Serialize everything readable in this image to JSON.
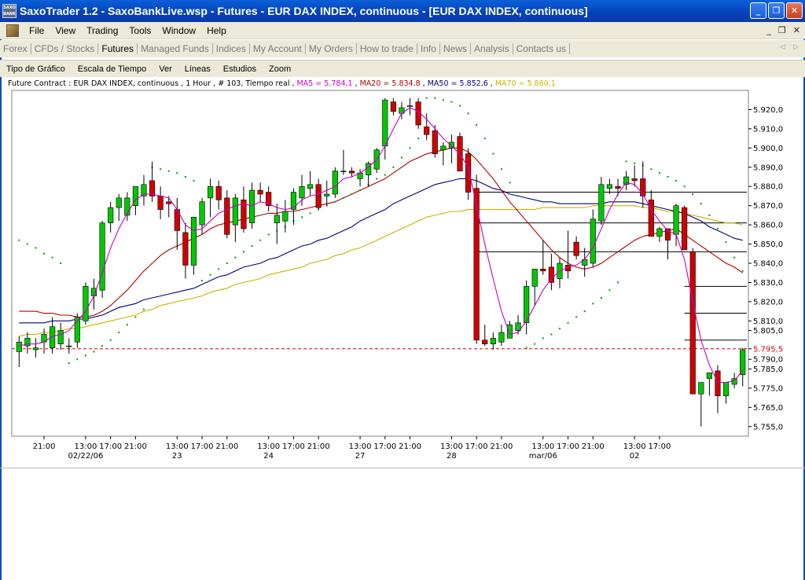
{
  "window": {
    "icon_text": "SAXO BANK",
    "title": "SaxoTrader 1.2 - SaxoBankLive.wsp - Futures - EUR DAX INDEX, continuous - [EUR DAX INDEX, continuous]",
    "minimize": "_",
    "maximize": "❐",
    "close": "✕"
  },
  "menu": {
    "items": [
      "File",
      "View",
      "Trading",
      "Tools",
      "Window",
      "Help"
    ],
    "mdi_min": "_",
    "mdi_restore": "❐",
    "mdi_close": "✕"
  },
  "tabs": {
    "items": [
      "Forex",
      "CFDs / Stocks",
      "Futures",
      "Managed Funds",
      "Indices",
      "My Account",
      "My Orders",
      "How to trade",
      "Info",
      "News",
      "Analysis",
      "Contacts us"
    ],
    "active": "Futures",
    "left_arrow": "◁",
    "right_arrow": "▷"
  },
  "chart_menu": {
    "items": [
      "Tipo de Gráfico",
      "Escala de Tiempo",
      "Ver",
      "Líneas",
      "Estudios",
      "Zoom"
    ]
  },
  "info": {
    "contract": "Future Contract : EUR DAX INDEX, continuous , 1 Hour , # 103, Tiempo real",
    "ma5": "MA5 = 5.784,1",
    "ma20": "MA20 = 5.834,8",
    "ma50": "MA50 = 5.852,6",
    "ma70": "MA70 = 5.860,1"
  },
  "colors": {
    "ma5": "#c800c8",
    "ma20": "#b00000",
    "ma50": "#000080",
    "ma70": "#c8b400",
    "up": "#00c800",
    "down": "#d00000",
    "sar": "#00a000",
    "last": "#e00000"
  },
  "chart_data": {
    "type": "candlestick",
    "symbol": "EUR DAX INDEX, continuous",
    "timeframe": "1 Hour",
    "ylim": [
      5750,
      5930
    ],
    "y_ticks": [
      "5.920,0",
      "5.910,0",
      "5.900,0",
      "5.890,0",
      "5.880,0",
      "5.870,0",
      "5.860,0",
      "5.850,0",
      "5.840,0",
      "5.830,0",
      "5.820,0",
      "5.810,0",
      "5.805,0",
      "5.795,5",
      "5.790,0",
      "5.785,0",
      "5.775,0",
      "5.765,0",
      "5.755,0"
    ],
    "y_tick_values": [
      5920,
      5910,
      5900,
      5890,
      5880,
      5870,
      5860,
      5850,
      5840,
      5830,
      5820,
      5810,
      5805,
      5795.5,
      5790,
      5785,
      5775,
      5765,
      5755
    ],
    "last_price_label": "5.795,5",
    "last_price": 5795.5,
    "x_tick_labels": [
      "21:00",
      "13:00",
      "17:00",
      "21:00",
      "13:00",
      "17:00",
      "21:00",
      "13:00",
      "17:00",
      "21:00",
      "13:00",
      "17:00",
      "21:00",
      "13:00",
      "17:00",
      "21:00",
      "13:00",
      "17:00",
      "21:00",
      "13:00",
      "17:00"
    ],
    "x_tick_index": [
      3,
      8,
      11,
      14,
      19,
      22,
      25,
      30,
      33,
      36,
      41,
      44,
      47,
      52,
      55,
      58,
      63,
      66,
      69,
      74,
      77
    ],
    "day_labels": [
      "02/22/06",
      "23",
      "24",
      "27",
      "28",
      "mar/06",
      "02"
    ],
    "day_label_index": [
      8,
      19,
      30,
      41,
      52,
      63,
      74
    ],
    "candles": [
      [
        5794,
        5802,
        5786,
        5799
      ],
      [
        5797,
        5804,
        5793,
        5801
      ],
      [
        5795,
        5801,
        5791,
        5796
      ],
      [
        5799,
        5806,
        5793,
        5803
      ],
      [
        5796,
        5812,
        5793,
        5807
      ],
      [
        5798,
        5809,
        5795,
        5805
      ],
      [
        5797,
        5801,
        5793,
        5797
      ],
      [
        5799,
        5814,
        5796,
        5812
      ],
      [
        5810,
        5830,
        5808,
        5828
      ],
      [
        5823,
        5832,
        5816,
        5827
      ],
      [
        5826,
        5862,
        5822,
        5861
      ],
      [
        5861,
        5872,
        5856,
        5869
      ],
      [
        5869,
        5876,
        5862,
        5874
      ],
      [
        5865,
        5877,
        5862,
        5874
      ],
      [
        5870,
        5880,
        5865,
        5880
      ],
      [
        5875,
        5886,
        5870,
        5881
      ],
      [
        5883,
        5893,
        5872,
        5875
      ],
      [
        5875,
        5880,
        5863,
        5868
      ],
      [
        5872,
        5875,
        5864,
        5871
      ],
      [
        5868,
        5874,
        5847,
        5857
      ],
      [
        5856,
        5861,
        5832,
        5839
      ],
      [
        5839,
        5864,
        5834,
        5864
      ],
      [
        5860,
        5874,
        5855,
        5872
      ],
      [
        5874,
        5884,
        5864,
        5880
      ],
      [
        5880,
        5883,
        5868,
        5873
      ],
      [
        5874,
        5878,
        5853,
        5855
      ],
      [
        5860,
        5876,
        5851,
        5874
      ],
      [
        5873,
        5880,
        5856,
        5858
      ],
      [
        5861,
        5882,
        5858,
        5878
      ],
      [
        5878,
        5882,
        5872,
        5876
      ],
      [
        5877,
        5880,
        5867,
        5870
      ],
      [
        5861,
        5871,
        5850,
        5865
      ],
      [
        5862,
        5873,
        5856,
        5867
      ],
      [
        5868,
        5879,
        5860,
        5877
      ],
      [
        5874,
        5886,
        5870,
        5880
      ],
      [
        5879,
        5888,
        5875,
        5881
      ],
      [
        5881,
        5884,
        5868,
        5869
      ],
      [
        5875,
        5883,
        5870,
        5876
      ],
      [
        5876,
        5890,
        5874,
        5888
      ],
      [
        5888,
        5899,
        5886,
        5888
      ],
      [
        5888,
        5890,
        5885,
        5887
      ],
      [
        5884,
        5889,
        5880,
        5887
      ],
      [
        5886,
        5893,
        5880,
        5892
      ],
      [
        5889,
        5900,
        5887,
        5899
      ],
      [
        5901,
        5926,
        5894,
        5925
      ],
      [
        5924,
        5926,
        5917,
        5919
      ],
      [
        5918,
        5924,
        5915,
        5921
      ],
      [
        5922,
        5926,
        5917,
        5922
      ],
      [
        5924,
        5926,
        5910,
        5912
      ],
      [
        5911,
        5918,
        5904,
        5907
      ],
      [
        5909,
        5912,
        5895,
        5897
      ],
      [
        5899,
        5903,
        5891,
        5901
      ],
      [
        5900,
        5907,
        5892,
        5903
      ],
      [
        5906,
        5908,
        5890,
        5888
      ],
      [
        5897,
        5900,
        5873,
        5877
      ],
      [
        5879,
        5886,
        5798,
        5800
      ],
      [
        5800,
        5808,
        5797,
        5798
      ],
      [
        5798,
        5804,
        5795,
        5801
      ],
      [
        5799,
        5808,
        5797,
        5804
      ],
      [
        5801,
        5810,
        5801,
        5808
      ],
      [
        5805,
        5813,
        5803,
        5809
      ],
      [
        5809,
        5831,
        5803,
        5828
      ],
      [
        5828,
        5836,
        5818,
        5837
      ],
      [
        5837,
        5852,
        5834,
        5836
      ],
      [
        5838,
        5845,
        5826,
        5830
      ],
      [
        5832,
        5843,
        5827,
        5840
      ],
      [
        5839,
        5857,
        5832,
        5836
      ],
      [
        5851,
        5854,
        5842,
        5844
      ],
      [
        5839,
        5848,
        5833,
        5842
      ],
      [
        5840,
        5868,
        5838,
        5863
      ],
      [
        5862,
        5885,
        5860,
        5881
      ],
      [
        5879,
        5884,
        5876,
        5881
      ],
      [
        5880,
        5884,
        5875,
        5879
      ],
      [
        5881,
        5888,
        5878,
        5885
      ],
      [
        5884,
        5891,
        5880,
        5883
      ],
      [
        5884,
        5893,
        5869,
        5875
      ],
      [
        5873,
        5878,
        5855,
        5854
      ],
      [
        5854,
        5859,
        5851,
        5858
      ],
      [
        5858,
        5857,
        5842,
        5852
      ],
      [
        5855,
        5871,
        5849,
        5870
      ],
      [
        5869,
        5870,
        5851,
        5847
      ],
      [
        5846,
        5848,
        5774,
        5772
      ],
      [
        5772,
        5776,
        5755,
        5778
      ],
      [
        5780,
        5783,
        5771,
        5783
      ],
      [
        5784,
        5787,
        5762,
        5771
      ],
      [
        5771,
        5778,
        5767,
        5778
      ],
      [
        5777,
        5783,
        5775,
        5780
      ],
      [
        5782,
        5796,
        5776,
        5795
      ]
    ],
    "ma5": [
      5797,
      5798,
      5798,
      5799,
      5802,
      5803,
      5805,
      5810,
      5815,
      5823,
      5835,
      5848,
      5858,
      5866,
      5873,
      5876,
      5876,
      5875,
      5874,
      5868,
      5860,
      5857,
      5858,
      5862,
      5866,
      5868,
      5870,
      5871,
      5870,
      5872,
      5871,
      5869,
      5868,
      5869,
      5873,
      5875,
      5876,
      5878,
      5880,
      5884,
      5885,
      5887,
      5890,
      5894,
      5901,
      5910,
      5918,
      5921,
      5919,
      5915,
      5910,
      5905,
      5901,
      5897,
      5890,
      5870,
      5850,
      5832,
      5815,
      5803,
      5804,
      5810,
      5818,
      5826,
      5832,
      5836,
      5838,
      5839,
      5842,
      5848,
      5858,
      5868,
      5876,
      5882,
      5881,
      5876,
      5868,
      5862,
      5857,
      5855,
      5842,
      5820,
      5800,
      5787,
      5778,
      5778,
      5779,
      5784
    ],
    "ma20": [
      5815,
      5815,
      5815,
      5814,
      5814,
      5813,
      5813,
      5812,
      5812,
      5813,
      5815,
      5818,
      5822,
      5826,
      5831,
      5836,
      5840,
      5844,
      5847,
      5849,
      5851,
      5853,
      5855,
      5858,
      5860,
      5861,
      5862,
      5863,
      5864,
      5865,
      5866,
      5866,
      5867,
      5867,
      5868,
      5869,
      5870,
      5871,
      5872,
      5874,
      5876,
      5878,
      5880,
      5882,
      5884,
      5887,
      5890,
      5893,
      5895,
      5897,
      5898,
      5899,
      5900,
      5900,
      5898,
      5894,
      5889,
      5884,
      5878,
      5872,
      5867,
      5862,
      5857,
      5852,
      5847,
      5843,
      5840,
      5838,
      5837,
      5838,
      5840,
      5843,
      5846,
      5849,
      5852,
      5854,
      5855,
      5856,
      5857,
      5858,
      5855,
      5852,
      5849,
      5846,
      5843,
      5840,
      5838,
      5835
    ],
    "ma50": [
      5809,
      5809,
      5809,
      5809,
      5810,
      5810,
      5810,
      5811,
      5811,
      5812,
      5813,
      5815,
      5817,
      5818,
      5819,
      5821,
      5822,
      5823,
      5824,
      5825,
      5826,
      5827,
      5829,
      5831,
      5833,
      5834,
      5836,
      5838,
      5839,
      5840,
      5842,
      5843,
      5845,
      5847,
      5849,
      5850,
      5852,
      5853,
      5855,
      5857,
      5859,
      5862,
      5864,
      5866,
      5868,
      5871,
      5873,
      5875,
      5877,
      5879,
      5881,
      5882,
      5883,
      5884,
      5884,
      5883,
      5881,
      5879,
      5878,
      5876,
      5875,
      5874,
      5873,
      5872,
      5872,
      5871,
      5871,
      5871,
      5871,
      5871,
      5871,
      5872,
      5872,
      5872,
      5872,
      5871,
      5870,
      5869,
      5868,
      5867,
      5866,
      5864,
      5862,
      5859,
      5857,
      5855,
      5853,
      5852
    ],
    "ma70": [
      5802,
      5803,
      5803,
      5804,
      5804,
      5805,
      5806,
      5806,
      5807,
      5808,
      5809,
      5810,
      5811,
      5812,
      5813,
      5815,
      5816,
      5818,
      5819,
      5820,
      5821,
      5822,
      5823,
      5825,
      5826,
      5827,
      5829,
      5830,
      5831,
      5832,
      5834,
      5835,
      5836,
      5837,
      5838,
      5840,
      5841,
      5842,
      5844,
      5845,
      5847,
      5848,
      5850,
      5852,
      5854,
      5856,
      5858,
      5860,
      5862,
      5864,
      5865,
      5866,
      5867,
      5867,
      5868,
      5868,
      5868,
      5868,
      5868,
      5868,
      5868,
      5868,
      5868,
      5869,
      5869,
      5869,
      5869,
      5869,
      5869,
      5870,
      5870,
      5870,
      5870,
      5870,
      5870,
      5869,
      5869,
      5868,
      5867,
      5867,
      5866,
      5865,
      5864,
      5863,
      5862,
      5861,
      5861,
      5860
    ],
    "sar": [
      5852,
      5850,
      5848,
      5845,
      5843,
      5840,
      5788,
      5790,
      5792,
      5794,
      5797,
      5800,
      5804,
      5808,
      5812,
      5816,
      5890,
      5889,
      5888,
      5887,
      5885,
      5883,
      5831,
      5834,
      5837,
      5840,
      5843,
      5846,
      5849,
      5852,
      5855,
      5857,
      5859,
      5862,
      5864,
      5866,
      5868,
      5870,
      5872,
      5874,
      5876,
      5878,
      5881,
      5884,
      5886,
      5890,
      5895,
      5900,
      5905,
      5926,
      5926,
      5925,
      5924,
      5922,
      5918,
      5912,
      5905,
      5897,
      5889,
      5882,
      5875,
      5796,
      5798,
      5801,
      5803,
      5806,
      5809,
      5812,
      5815,
      5819,
      5822,
      5826,
      5830,
      5893,
      5892,
      5891,
      5889,
      5887,
      5885,
      5883,
      5880,
      5876,
      5871,
      5865,
      5858,
      5851,
      5843,
      5836
    ],
    "hlines": [
      {
        "y": 5877,
        "from": 55,
        "to": 87
      },
      {
        "y": 5861,
        "from": 55,
        "to": 87
      },
      {
        "y": 5846,
        "from": 55,
        "to": 87
      },
      {
        "y": 5828,
        "from": 80,
        "to": 87
      },
      {
        "y": 5814,
        "from": 80,
        "to": 87
      },
      {
        "y": 5800,
        "from": 80,
        "to": 87
      }
    ]
  }
}
